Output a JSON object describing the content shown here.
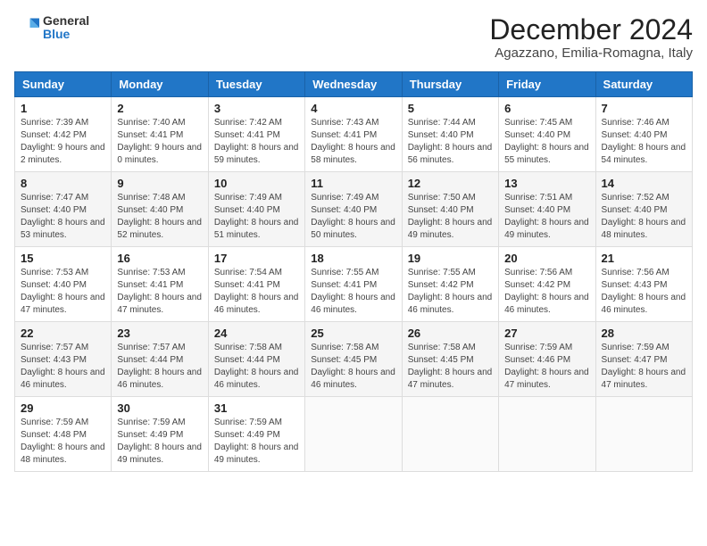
{
  "logo": {
    "general": "General",
    "blue": "Blue"
  },
  "title": "December 2024",
  "location": "Agazzano, Emilia-Romagna, Italy",
  "days_of_week": [
    "Sunday",
    "Monday",
    "Tuesday",
    "Wednesday",
    "Thursday",
    "Friday",
    "Saturday"
  ],
  "weeks": [
    [
      {
        "day": "1",
        "sunrise": "7:39 AM",
        "sunset": "4:42 PM",
        "daylight": "9 hours and 2 minutes."
      },
      {
        "day": "2",
        "sunrise": "7:40 AM",
        "sunset": "4:41 PM",
        "daylight": "9 hours and 0 minutes."
      },
      {
        "day": "3",
        "sunrise": "7:42 AM",
        "sunset": "4:41 PM",
        "daylight": "8 hours and 59 minutes."
      },
      {
        "day": "4",
        "sunrise": "7:43 AM",
        "sunset": "4:41 PM",
        "daylight": "8 hours and 58 minutes."
      },
      {
        "day": "5",
        "sunrise": "7:44 AM",
        "sunset": "4:40 PM",
        "daylight": "8 hours and 56 minutes."
      },
      {
        "day": "6",
        "sunrise": "7:45 AM",
        "sunset": "4:40 PM",
        "daylight": "8 hours and 55 minutes."
      },
      {
        "day": "7",
        "sunrise": "7:46 AM",
        "sunset": "4:40 PM",
        "daylight": "8 hours and 54 minutes."
      }
    ],
    [
      {
        "day": "8",
        "sunrise": "7:47 AM",
        "sunset": "4:40 PM",
        "daylight": "8 hours and 53 minutes."
      },
      {
        "day": "9",
        "sunrise": "7:48 AM",
        "sunset": "4:40 PM",
        "daylight": "8 hours and 52 minutes."
      },
      {
        "day": "10",
        "sunrise": "7:49 AM",
        "sunset": "4:40 PM",
        "daylight": "8 hours and 51 minutes."
      },
      {
        "day": "11",
        "sunrise": "7:49 AM",
        "sunset": "4:40 PM",
        "daylight": "8 hours and 50 minutes."
      },
      {
        "day": "12",
        "sunrise": "7:50 AM",
        "sunset": "4:40 PM",
        "daylight": "8 hours and 49 minutes."
      },
      {
        "day": "13",
        "sunrise": "7:51 AM",
        "sunset": "4:40 PM",
        "daylight": "8 hours and 49 minutes."
      },
      {
        "day": "14",
        "sunrise": "7:52 AM",
        "sunset": "4:40 PM",
        "daylight": "8 hours and 48 minutes."
      }
    ],
    [
      {
        "day": "15",
        "sunrise": "7:53 AM",
        "sunset": "4:40 PM",
        "daylight": "8 hours and 47 minutes."
      },
      {
        "day": "16",
        "sunrise": "7:53 AM",
        "sunset": "4:41 PM",
        "daylight": "8 hours and 47 minutes."
      },
      {
        "day": "17",
        "sunrise": "7:54 AM",
        "sunset": "4:41 PM",
        "daylight": "8 hours and 46 minutes."
      },
      {
        "day": "18",
        "sunrise": "7:55 AM",
        "sunset": "4:41 PM",
        "daylight": "8 hours and 46 minutes."
      },
      {
        "day": "19",
        "sunrise": "7:55 AM",
        "sunset": "4:42 PM",
        "daylight": "8 hours and 46 minutes."
      },
      {
        "day": "20",
        "sunrise": "7:56 AM",
        "sunset": "4:42 PM",
        "daylight": "8 hours and 46 minutes."
      },
      {
        "day": "21",
        "sunrise": "7:56 AM",
        "sunset": "4:43 PM",
        "daylight": "8 hours and 46 minutes."
      }
    ],
    [
      {
        "day": "22",
        "sunrise": "7:57 AM",
        "sunset": "4:43 PM",
        "daylight": "8 hours and 46 minutes."
      },
      {
        "day": "23",
        "sunrise": "7:57 AM",
        "sunset": "4:44 PM",
        "daylight": "8 hours and 46 minutes."
      },
      {
        "day": "24",
        "sunrise": "7:58 AM",
        "sunset": "4:44 PM",
        "daylight": "8 hours and 46 minutes."
      },
      {
        "day": "25",
        "sunrise": "7:58 AM",
        "sunset": "4:45 PM",
        "daylight": "8 hours and 46 minutes."
      },
      {
        "day": "26",
        "sunrise": "7:58 AM",
        "sunset": "4:45 PM",
        "daylight": "8 hours and 47 minutes."
      },
      {
        "day": "27",
        "sunrise": "7:59 AM",
        "sunset": "4:46 PM",
        "daylight": "8 hours and 47 minutes."
      },
      {
        "day": "28",
        "sunrise": "7:59 AM",
        "sunset": "4:47 PM",
        "daylight": "8 hours and 47 minutes."
      }
    ],
    [
      {
        "day": "29",
        "sunrise": "7:59 AM",
        "sunset": "4:48 PM",
        "daylight": "8 hours and 48 minutes."
      },
      {
        "day": "30",
        "sunrise": "7:59 AM",
        "sunset": "4:49 PM",
        "daylight": "8 hours and 49 minutes."
      },
      {
        "day": "31",
        "sunrise": "7:59 AM",
        "sunset": "4:49 PM",
        "daylight": "8 hours and 49 minutes."
      },
      null,
      null,
      null,
      null
    ]
  ]
}
